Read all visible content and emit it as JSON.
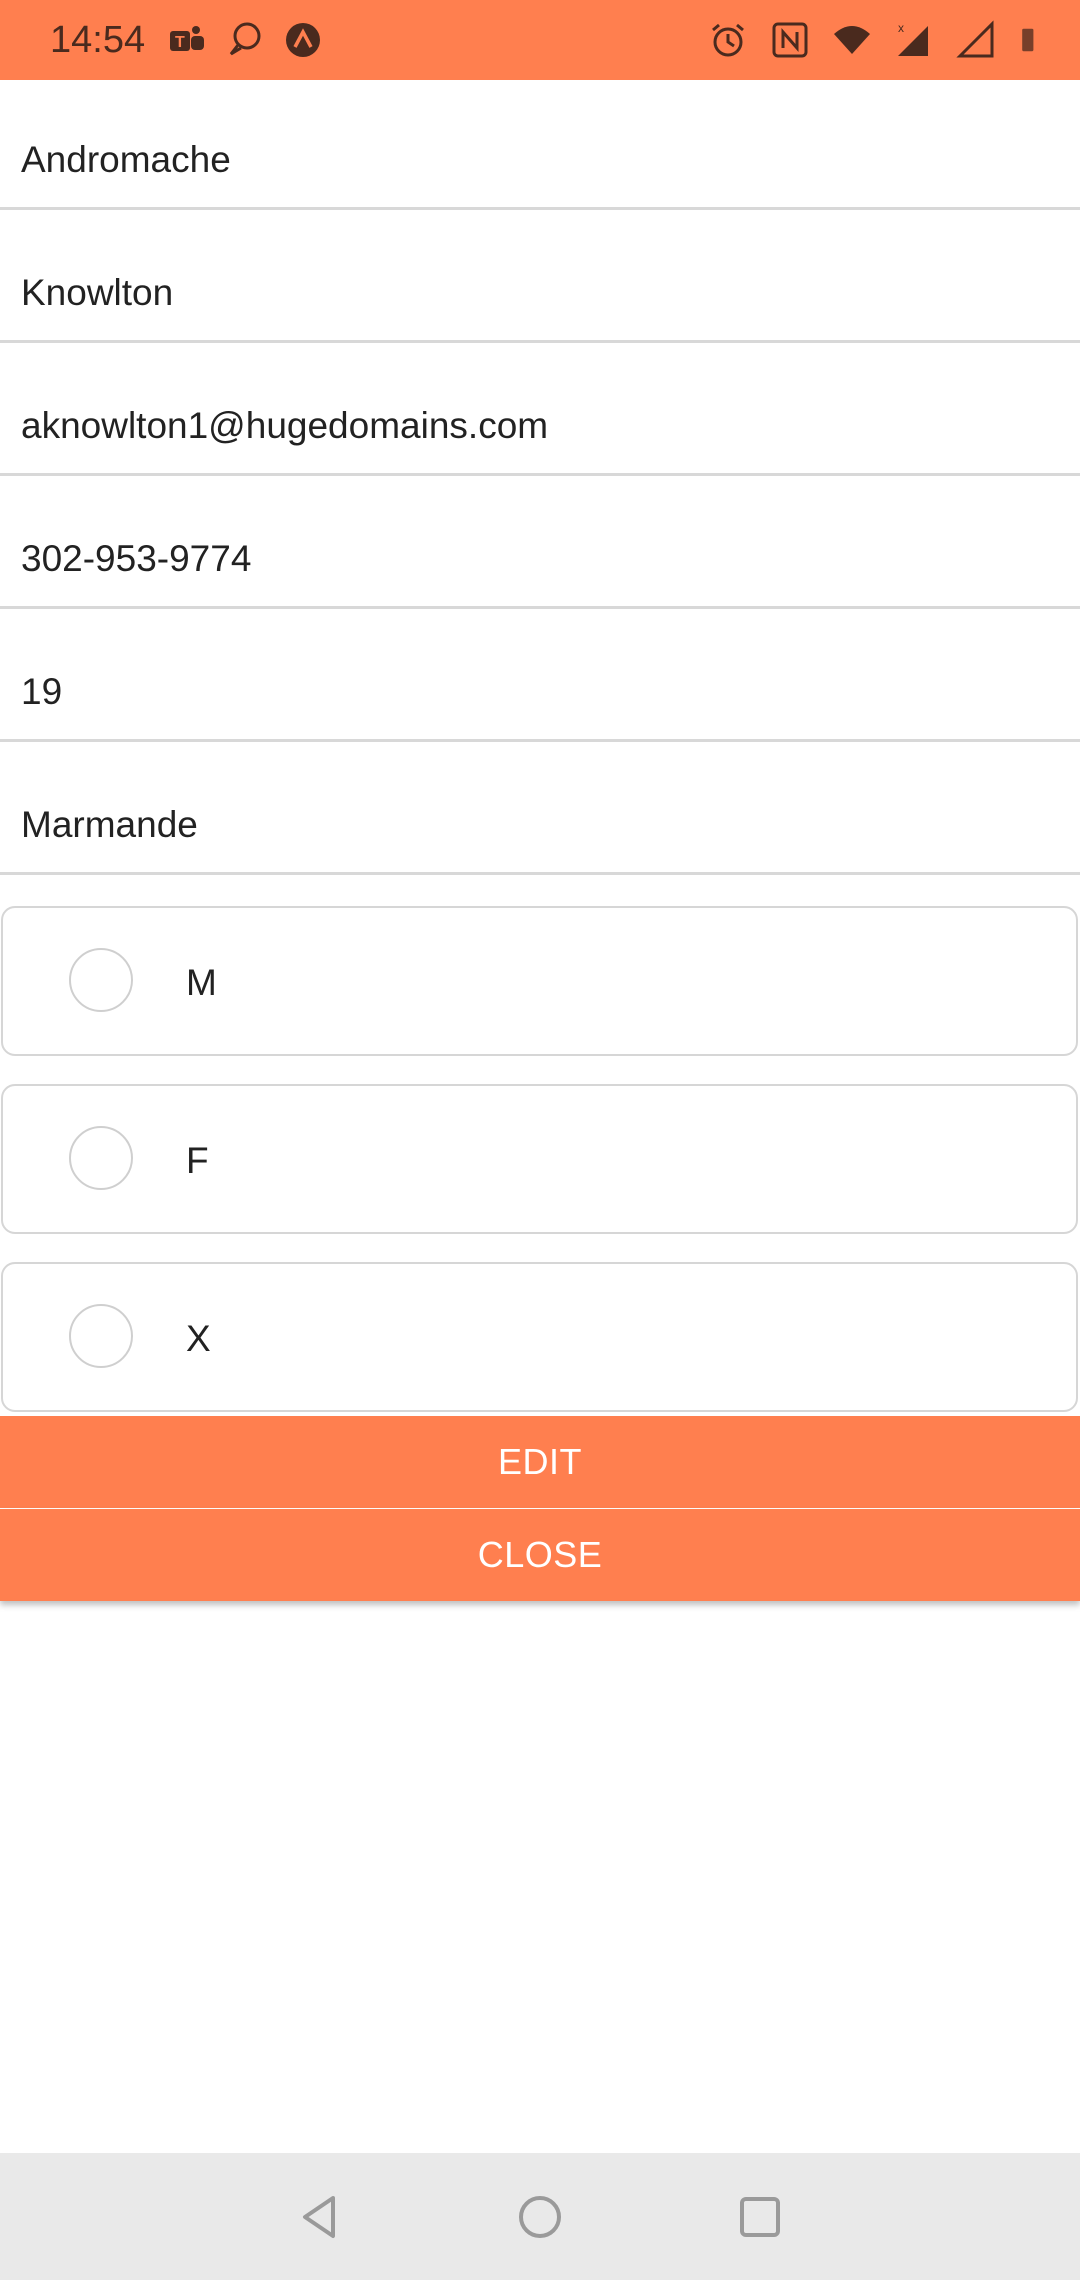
{
  "status_bar": {
    "time": "14:54",
    "left_icons": [
      "teams-icon",
      "chat-bubble-icon",
      "app-icon"
    ],
    "right_icons": [
      "alarm-icon",
      "nfc-icon",
      "wifi-icon",
      "signal-x-icon",
      "signal-icon",
      "battery-icon"
    ],
    "background": "#ff7f4f"
  },
  "form": {
    "first_name": "Andromache",
    "last_name": "Knowlton",
    "email": "aknowlton1@hugedomains.com",
    "phone": "302-953-9774",
    "age": "19",
    "city": "Marmande"
  },
  "gender_options": [
    {
      "label": "M",
      "selected": false
    },
    {
      "label": "F",
      "selected": false
    },
    {
      "label": "X",
      "selected": false
    }
  ],
  "buttons": {
    "edit_label": "EDIT",
    "close_label": "CLOSE",
    "color": "#ff7f4f"
  },
  "nav_bar": {
    "icons": [
      "back-icon",
      "home-icon",
      "recents-icon"
    ]
  }
}
